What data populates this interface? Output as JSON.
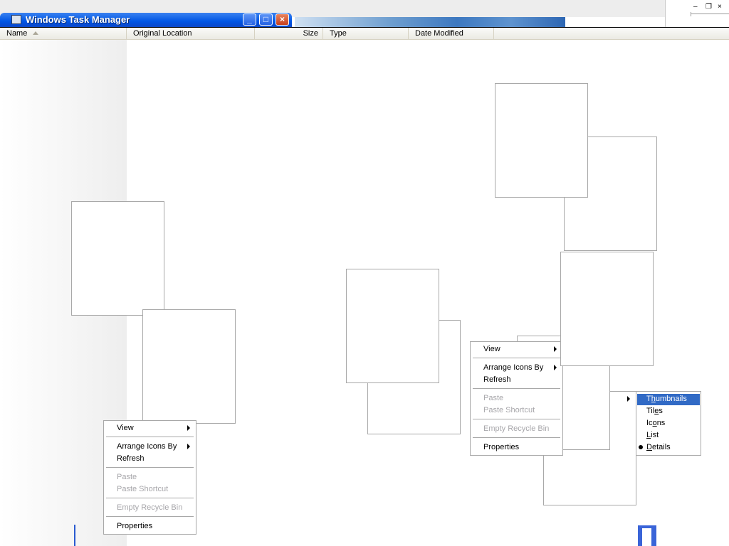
{
  "window": {
    "title": "Windows Task Manager",
    "minimize_glyph": "_",
    "maximize_glyph": "□",
    "close_glyph": "×"
  },
  "mini_pane": {
    "minimize_glyph": "–",
    "restore_glyph": "❐",
    "close_glyph": "×"
  },
  "columns": [
    "Name",
    "Original Location",
    "Size",
    "Type",
    "Date Modified"
  ],
  "context_menu": {
    "view": "View",
    "arrange": "Arrange Icons By",
    "refresh": "Refresh",
    "paste": "Paste",
    "paste_shortcut": "Paste Shortcut",
    "empty_bin": "Empty Recycle Bin",
    "properties": "Properties"
  },
  "view_submenu": {
    "thumbnails": "Thumbnails",
    "tiles": "Tiles",
    "icons": "Icons",
    "list": "List",
    "details": "Details",
    "selected": "Details",
    "highlighted": "Thumbnails"
  },
  "colors": {
    "highlight": "#316ac5",
    "titlebar": "#0055e5",
    "disabled_text": "#a7a6aa"
  }
}
